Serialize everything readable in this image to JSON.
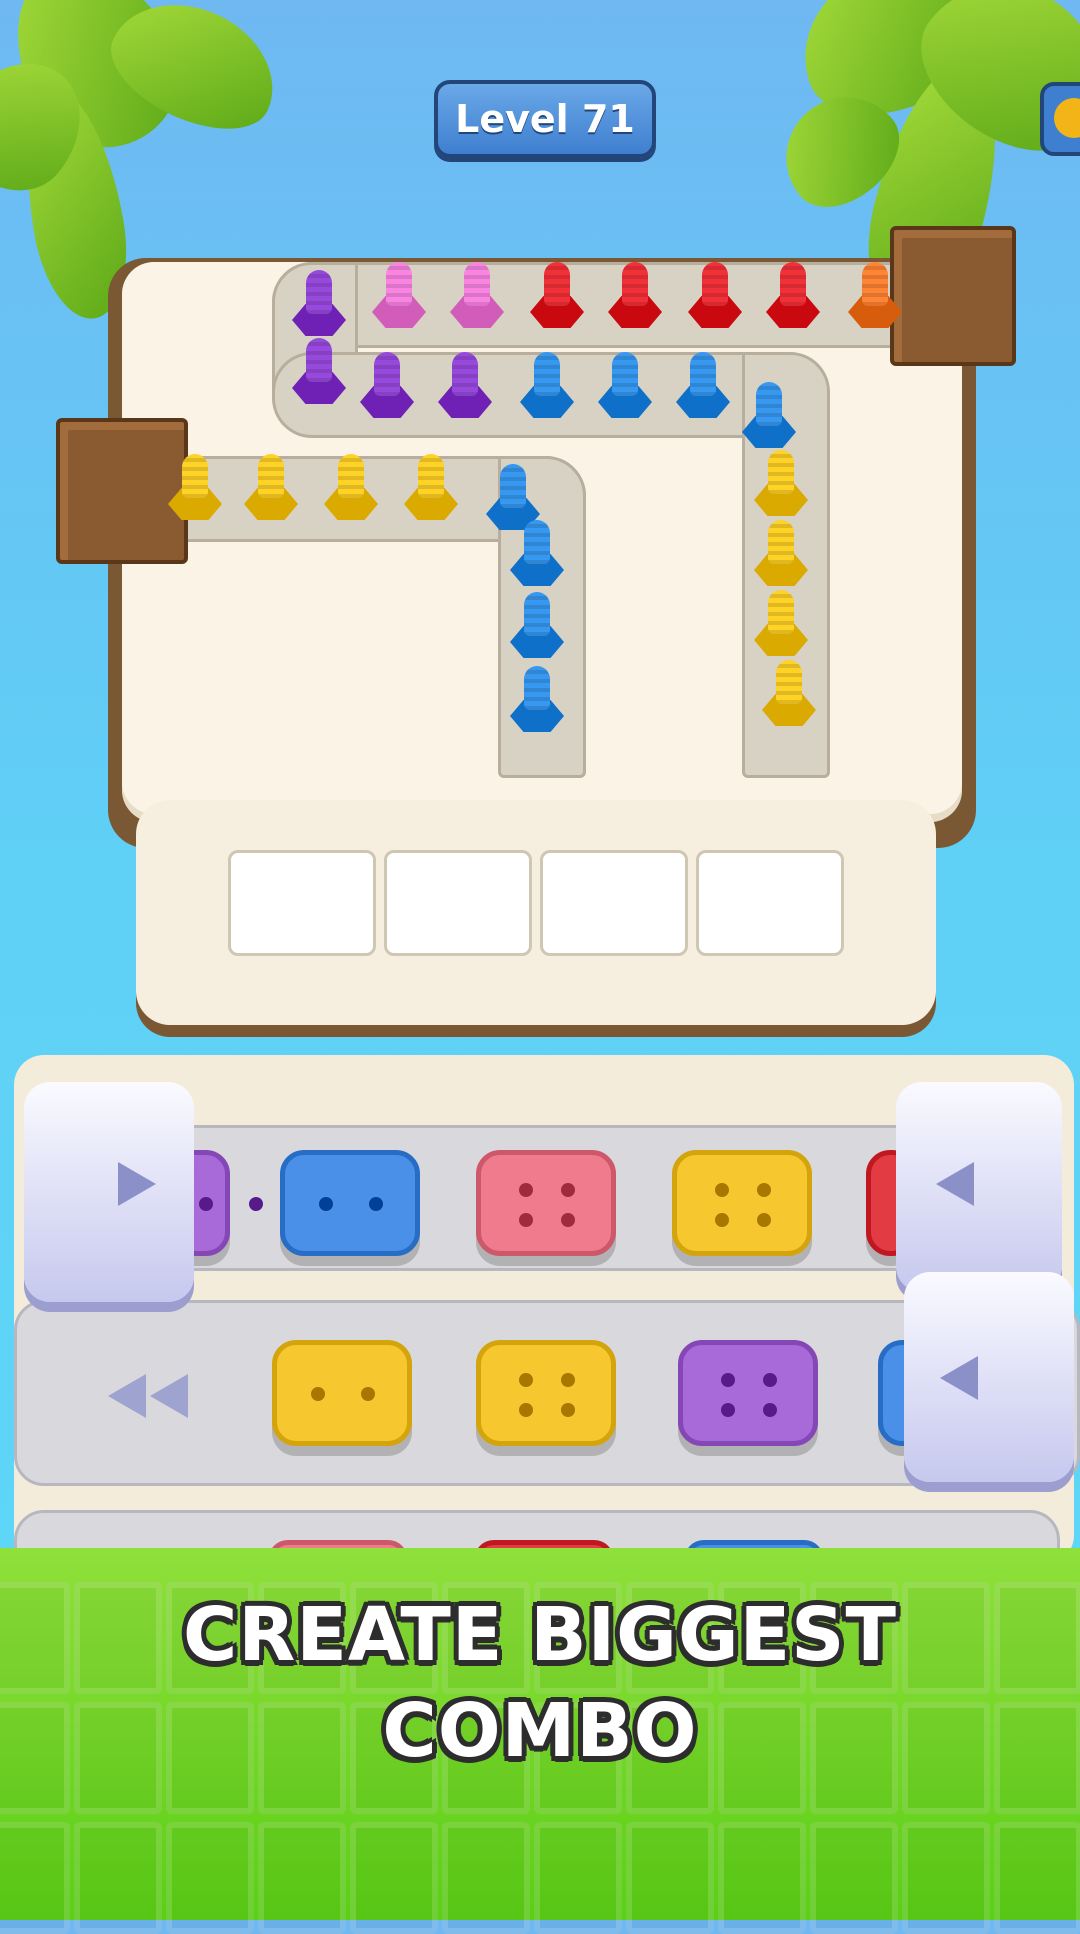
{
  "hud": {
    "level_label": "Level 71",
    "coin_icon": "coin-icon"
  },
  "board": {
    "slots_total": 4,
    "slots_filled": 0,
    "bolt_colors": {
      "purple": "#8e3fd3",
      "pink": "#f07ad8",
      "red": "#e8262e",
      "orange": "#f57a2a",
      "blue": "#2c8ee6",
      "yellow": "#f8c81c"
    }
  },
  "puzzle": {
    "tile_colors": {
      "blue": "#4a90e8",
      "pink": "#ef7b8d",
      "yellow": "#f7c730",
      "purple": "#a86ad9",
      "red": "#e33b44"
    }
  },
  "banner": {
    "line1": "CREATE BIGGEST",
    "line2": "COMBO"
  }
}
